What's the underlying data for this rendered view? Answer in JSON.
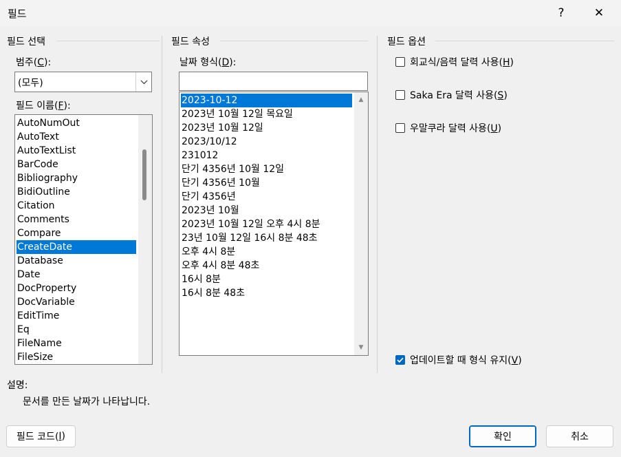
{
  "window": {
    "title": "필드",
    "help_label": "?",
    "close_label": "✕"
  },
  "field_select": {
    "heading": "필드 선택",
    "category_label": "범주(",
    "category_key": "C",
    "category_suffix": "):",
    "category_value": "(모두)",
    "names_label": "필드 이름(",
    "names_key": "F",
    "names_suffix": "):",
    "names": [
      "AutoNumOut",
      "AutoText",
      "AutoTextList",
      "BarCode",
      "Bibliography",
      "BidiOutline",
      "Citation",
      "Comments",
      "Compare",
      "CreateDate",
      "Database",
      "Date",
      "DocProperty",
      "DocVariable",
      "EditTime",
      "Eq",
      "FileName",
      "FileSize"
    ],
    "selected_name": "CreateDate"
  },
  "field_props": {
    "heading": "필드 속성",
    "format_label": "날짜 형식(",
    "format_key": "D",
    "format_suffix": "):",
    "format_value": "",
    "formats": [
      "2023-10-12",
      "2023년 10월 12일 목요일",
      "2023년 10월 12일",
      "2023/10/12",
      "231012",
      "단기 4356년 10월 12일",
      "단기 4356년 10월",
      "단기 4356년",
      "2023년 10월",
      "2023년 10월 12일 오후 4시 8분",
      "23년 10월 12일 16시 8분 48초",
      "오후 4시 8분",
      "오후 4시 8분 48초",
      "16시 8분",
      "16시 8분 48초"
    ],
    "selected_format": "2023-10-12"
  },
  "field_options": {
    "heading": "필드 옵션",
    "options": [
      {
        "label": "회교식/음력 달력 사용(",
        "key": "H",
        "suffix": ")",
        "checked": false
      },
      {
        "label": "Saka Era 달력 사용(",
        "key": "S",
        "suffix": ")",
        "checked": false
      },
      {
        "label": "우말쿠라 달력 사용(",
        "key": "U",
        "suffix": ")",
        "checked": false
      }
    ],
    "preserve": {
      "label": "업데이트할 때 형식 유지(",
      "key": "V",
      "suffix": ")",
      "checked": true
    }
  },
  "description": {
    "label": "설명:",
    "text": "문서를 만든 날짜가 나타납니다."
  },
  "buttons": {
    "field_code_label": "필드 코드(",
    "field_code_key": "I",
    "field_code_suffix": ")",
    "ok": "확인",
    "cancel": "취소"
  }
}
